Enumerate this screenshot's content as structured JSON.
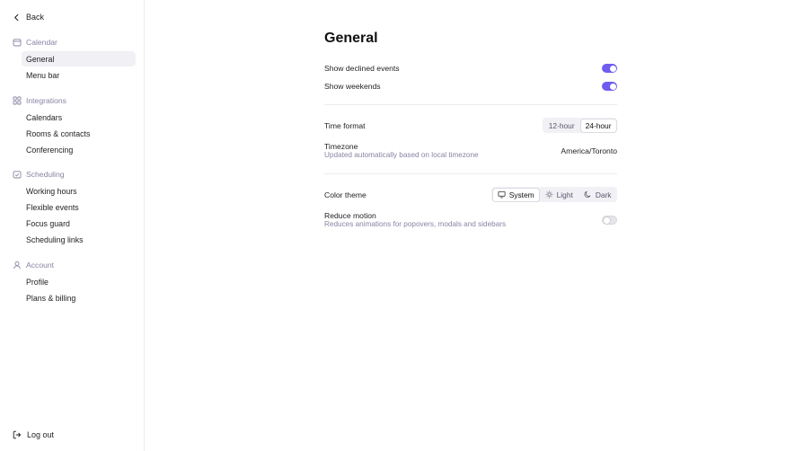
{
  "sidebar": {
    "back_label": "Back",
    "sections": [
      {
        "title": "Calendar",
        "icon": "calendar-icon",
        "items": [
          "General",
          "Menu bar"
        ]
      },
      {
        "title": "Integrations",
        "icon": "grid-plus-icon",
        "items": [
          "Calendars",
          "Rooms & contacts",
          "Conferencing"
        ]
      },
      {
        "title": "Scheduling",
        "icon": "calendar-check-icon",
        "items": [
          "Working hours",
          "Flexible events",
          "Focus guard",
          "Scheduling links"
        ]
      },
      {
        "title": "Account",
        "icon": "user-icon",
        "items": [
          "Profile",
          "Plans & billing"
        ]
      }
    ],
    "active_item": "General",
    "logout_label": "Log out"
  },
  "main": {
    "title": "General",
    "show_declined": {
      "label": "Show declined events",
      "on": true
    },
    "show_weekends": {
      "label": "Show weekends",
      "on": true
    },
    "time_format": {
      "label": "Time format",
      "options": [
        "12-hour",
        "24-hour"
      ],
      "selected": "24-hour"
    },
    "timezone": {
      "label": "Timezone",
      "sublabel": "Updated automatically based on local timezone",
      "value": "America/Toronto"
    },
    "color_theme": {
      "label": "Color theme",
      "options": [
        "System",
        "Light",
        "Dark"
      ],
      "selected": "System"
    },
    "reduce_motion": {
      "label": "Reduce motion",
      "sublabel": "Reduces animations for popovers, modals and sidebars",
      "on": false
    }
  },
  "colors": {
    "accent": "#6e5cf0",
    "muted_text": "#8a83a3",
    "active_bg": "#f1f0f4"
  }
}
